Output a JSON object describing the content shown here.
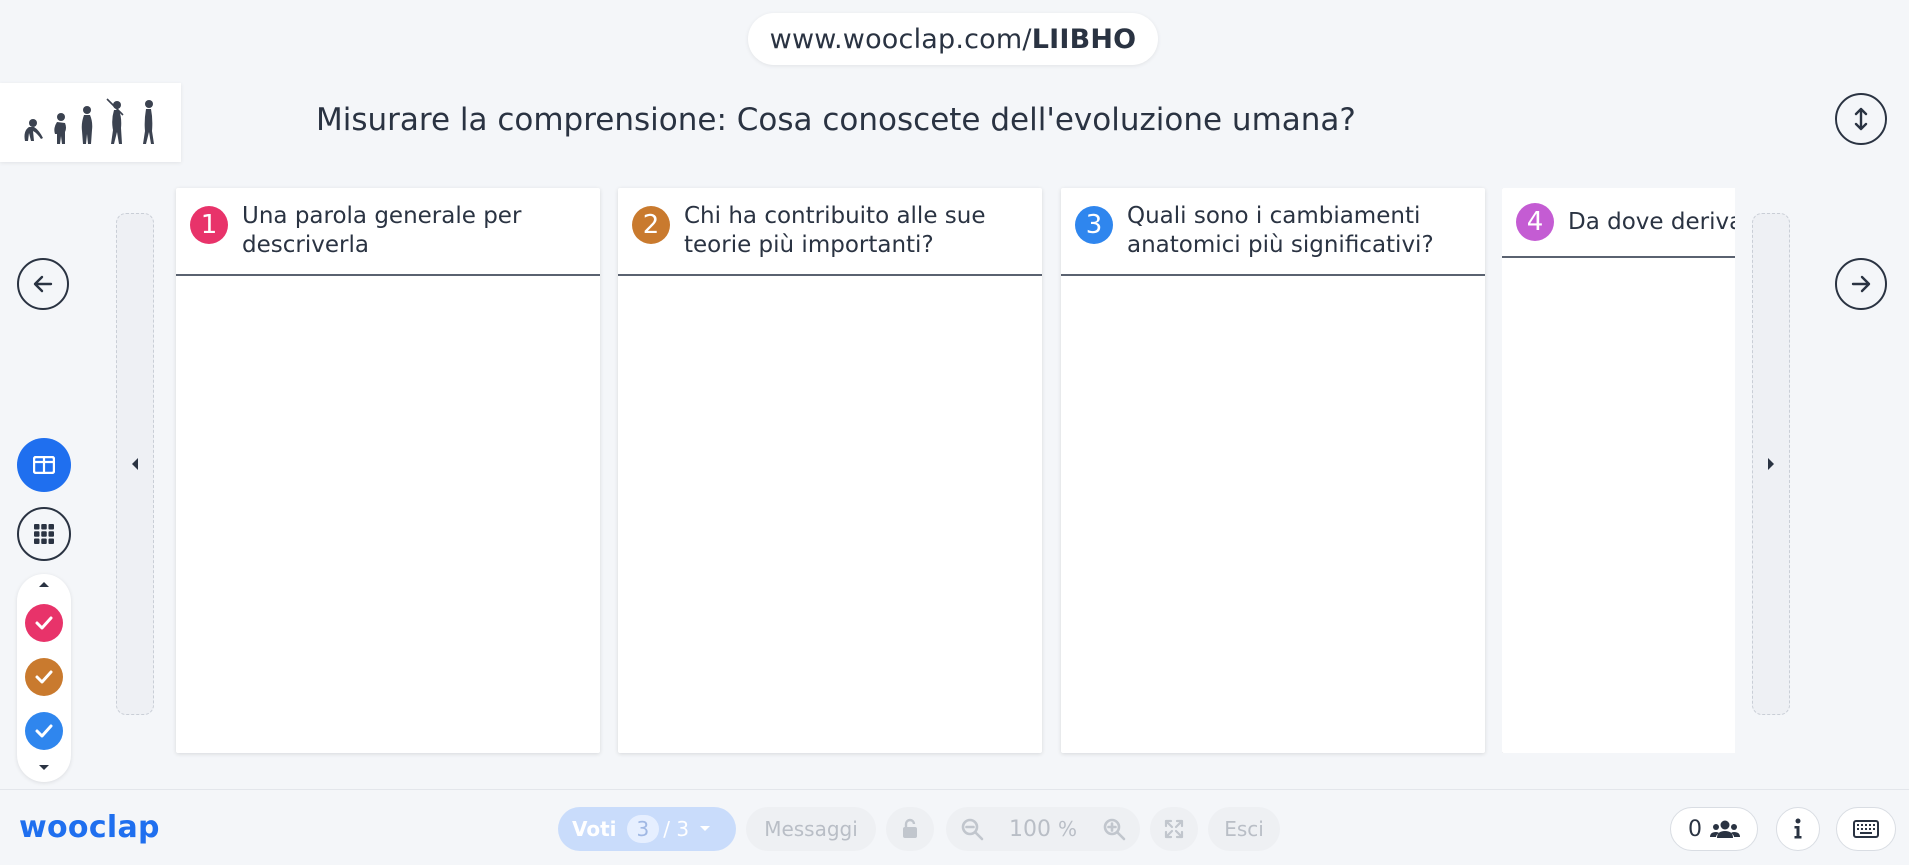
{
  "url": {
    "prefix": "www.wooclap.com/",
    "code": "LIIBHO"
  },
  "title": "Misurare la comprensione: Cosa conoscete dell'evoluzione umana?",
  "columns": [
    {
      "num": "1",
      "color": "#e8336a",
      "text": "Una parola generale per descriverla"
    },
    {
      "num": "2",
      "color": "#c97a2e",
      "text": "Chi ha contribuito alle sue teorie più importanti?"
    },
    {
      "num": "3",
      "color": "#2f86ee",
      "text": "Quali sono i cambiamenti anatomici più significativi?"
    },
    {
      "num": "4",
      "color": "#c45cd3",
      "text": "Da dove deriva"
    }
  ],
  "filters": [
    {
      "color": "#e8336a"
    },
    {
      "color": "#c97a2e"
    },
    {
      "color": "#2f86ee"
    }
  ],
  "footer": {
    "brand": "wooclap",
    "votes_label": "Voti",
    "votes_count": "3",
    "votes_total": "/ 3",
    "messages_label": "Messaggi",
    "zoom_value": "100",
    "zoom_unit": "%",
    "exit_label": "Esci",
    "participants": "0"
  },
  "icons": {
    "expand": "vertical-arrows-icon",
    "prev": "arrow-left-icon",
    "next": "arrow-right-icon",
    "columns_view": "columns-view-icon",
    "grid_view": "grid-view-icon",
    "lock": "lock-icon",
    "zoom_out": "zoom-out-icon",
    "zoom_in": "zoom-in-icon",
    "fullscreen": "fullscreen-icon",
    "participants": "people-icon",
    "info": "info-icon",
    "keyboard": "keyboard-icon"
  },
  "accent": "#1f6fef"
}
